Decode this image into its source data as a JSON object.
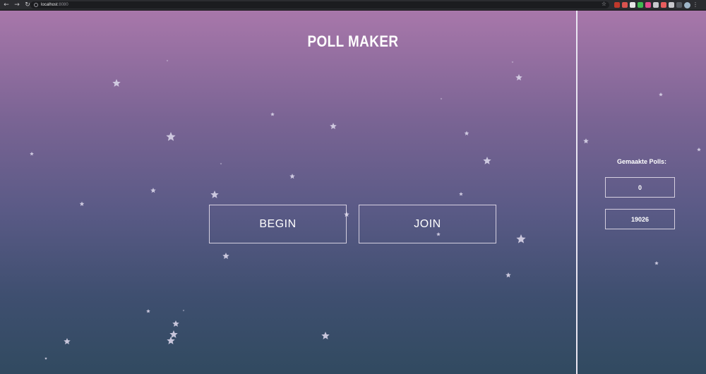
{
  "browser": {
    "host": "localhost",
    "port": ":8080"
  },
  "app": {
    "title": "POLL MAKER",
    "begin_label": "BEGIN",
    "join_label": "JOIN"
  },
  "sidebar": {
    "title": "Gemaakte Polls:",
    "counts": [
      "0",
      "19026"
    ]
  },
  "colors": {
    "gradient_top": "#a877aa",
    "gradient_bottom": "#314a60",
    "star": "#d8d4e8",
    "text": "#ffffff"
  }
}
